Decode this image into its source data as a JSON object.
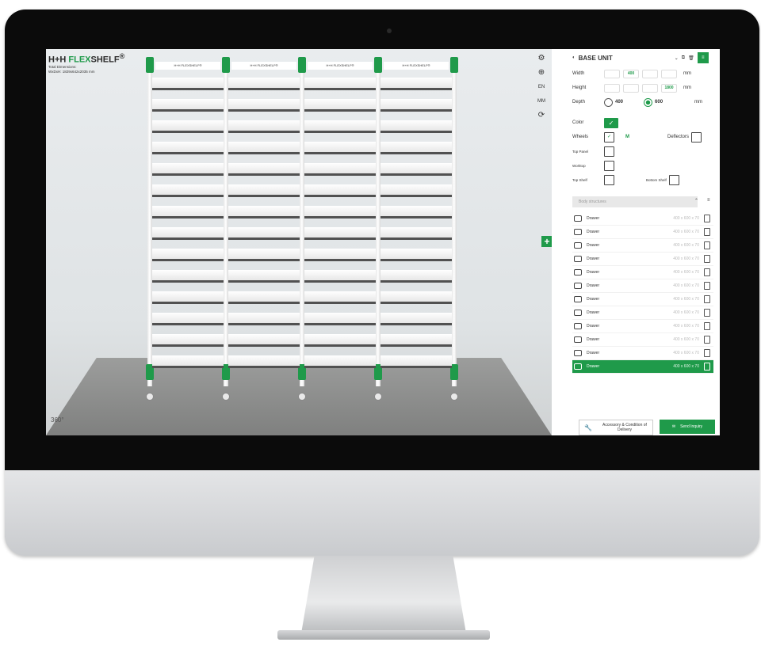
{
  "brand": {
    "prefix": "H+H",
    "flex": "FLEX",
    "shelf": "SHELF",
    "mark": "®"
  },
  "dimensions": {
    "line1": "Total Dimensions:",
    "line2": "WxDxH: 1829x642x2035 mm"
  },
  "rack_header": "H+H FLEXSHELF®",
  "rotate_label": "360°",
  "toolbar": {
    "lang": "EN",
    "unit": "MM"
  },
  "panel": {
    "title": "BASE UNIT",
    "width": {
      "label": "Width",
      "options": [
        "",
        "400",
        "",
        ""
      ],
      "selected": 1,
      "unit": "mm"
    },
    "height": {
      "label": "Height",
      "options": [
        "",
        "",
        "",
        "1800"
      ],
      "selected": 3,
      "unit": "mm"
    },
    "depth": {
      "label": "Depth",
      "opt1": "400",
      "opt2": "600",
      "unit": "mm"
    },
    "color": {
      "label": "Color"
    },
    "wheels": {
      "label": "Wheels",
      "m": "M",
      "deflectors": "Deflectors"
    },
    "top_panel": {
      "label": "Top Panel"
    },
    "worktop": {
      "label": "Worktop"
    },
    "top_shelf": {
      "label": "Top Shelf",
      "bottom": "Bottom Shelf"
    },
    "search_placeholder": "Body structures",
    "items": [
      {
        "name": "Drawer",
        "size": "400 x 600 x 70"
      },
      {
        "name": "Drawer",
        "size": "400 x 600 x 70"
      },
      {
        "name": "Drawer",
        "size": "400 x 600 x 70"
      },
      {
        "name": "Drawer",
        "size": "400 x 600 x 70"
      },
      {
        "name": "Drawer",
        "size": "400 x 600 x 70"
      },
      {
        "name": "Drawer",
        "size": "400 x 600 x 70"
      },
      {
        "name": "Drawer",
        "size": "400 x 600 x 70"
      },
      {
        "name": "Drawer",
        "size": "400 x 600 x 70"
      },
      {
        "name": "Drawer",
        "size": "400 x 600 x 70"
      },
      {
        "name": "Drawer",
        "size": "400 x 600 x 70"
      },
      {
        "name": "Drawer",
        "size": "400 x 600 x 70"
      },
      {
        "name": "Drawer",
        "size": "400 x 600 x 70"
      }
    ],
    "accessory_btn": "Accessory & Condition of Delivery",
    "send_btn": "Send Inquiry"
  },
  "colors": {
    "brand_green": "#1f9a4a"
  }
}
